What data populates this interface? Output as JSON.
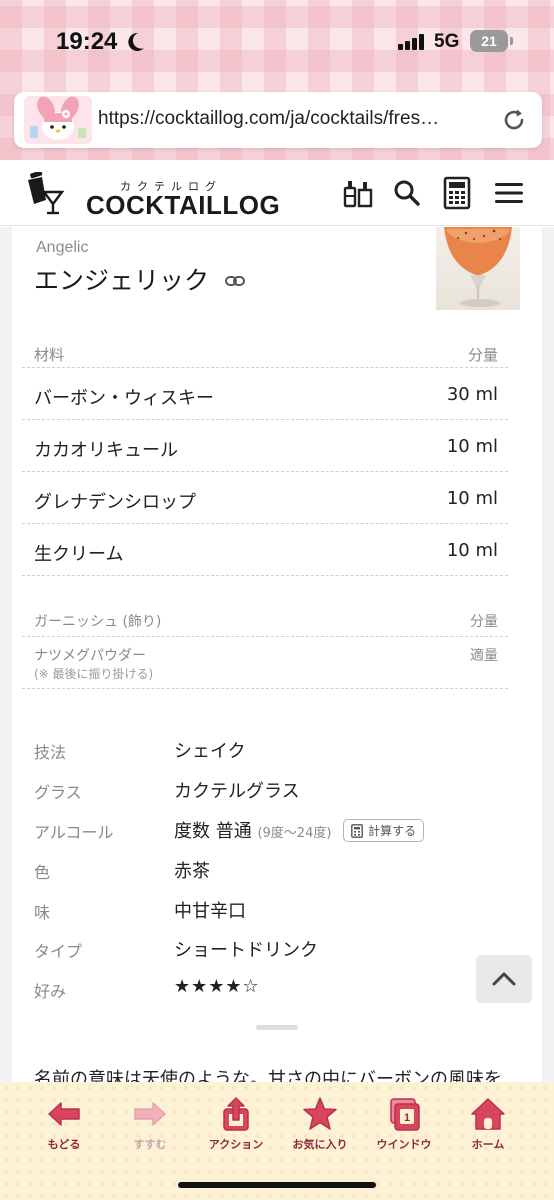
{
  "status_bar": {
    "time": "19:24",
    "network": "5G",
    "battery": "21"
  },
  "browser": {
    "url": "https://cocktaillog.com/ja/cocktails/fres…"
  },
  "site": {
    "logo_kana": "カクテルログ",
    "logo_text": "COCKTAILLOG"
  },
  "cocktail": {
    "name_en": "Angelic",
    "name_ja": "エンジェリック",
    "ingredients_header": {
      "label": "材料",
      "amount": "分量"
    },
    "ingredients": [
      {
        "name": "バーボン・ウィスキー",
        "amount": "30 ml"
      },
      {
        "name": "カカオリキュール",
        "amount": "10 ml"
      },
      {
        "name": "グレナデンシロップ",
        "amount": "10 ml"
      },
      {
        "name": "生クリーム",
        "amount": "10 ml"
      }
    ],
    "garnish_header": {
      "label": "ガーニッシュ (飾り)",
      "amount": "分量"
    },
    "garnish": {
      "name": "ナツメグパウダー",
      "note": "(※ 最後に振り掛ける)",
      "amount": "適量"
    },
    "specs": {
      "technique": {
        "key": "技法",
        "value": "シェイク"
      },
      "glass": {
        "key": "グラス",
        "value": "カクテルグラス"
      },
      "alcohol": {
        "key": "アルコール",
        "value": "度数 普通",
        "sub": "(9度〜24度)",
        "calc_button": "計算する"
      },
      "color": {
        "key": "色",
        "value": "赤茶"
      },
      "taste": {
        "key": "味",
        "value": "中甘辛口"
      },
      "type": {
        "key": "タイプ",
        "value": "ショートドリンク"
      },
      "preference": {
        "key": "好み",
        "stars": "★★★★☆",
        "rating": 4,
        "max": 5
      }
    },
    "description": "名前の意味は天使のような。甘さの中にバーボンの風味を"
  },
  "toolbar": {
    "back": "もどる",
    "forward": "すすむ",
    "action": "アクション",
    "favorites": "お気に入り",
    "window": "ウインドウ",
    "window_count": "1",
    "home": "ホーム"
  },
  "colors": {
    "accent_red": "#d9455f",
    "toolbar_bg": "#fdf2d6",
    "star": "#f5a300",
    "label_red": "#8d2a3c"
  }
}
